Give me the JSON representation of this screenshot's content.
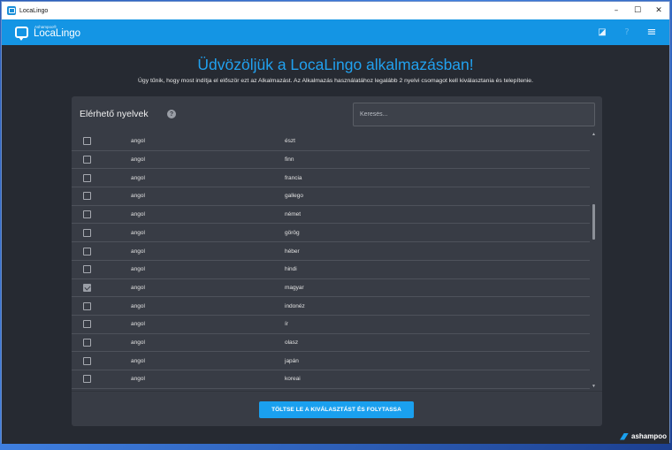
{
  "window": {
    "title": "LocaLingo",
    "minimize_glyph": "–",
    "maximize_glyph": "☐",
    "close_glyph": "✕"
  },
  "appbar": {
    "brand_small": "Ashampoo®",
    "brand_big": "LocaLingo",
    "icons": [
      "theme-toggle-icon",
      "help-icon",
      "menu-icon"
    ],
    "theme_glyph": "◪",
    "help_glyph": "?",
    "menu_glyph": "≡",
    "accent": "#1495e4"
  },
  "main": {
    "headline": "Üdvözöljük a LocaLingo alkalmazásban!",
    "subtitle": "Úgy tűnik, hogy most indítja el először ezt az Alkalmazást. Az Alkalmazás használatához legalább 2 nyelvi csomagot kell kiválasztania és telepítenie."
  },
  "panel": {
    "title": "Elérhető nyelvek",
    "help_glyph": "?",
    "search_placeholder": "Keresés...",
    "rows": [
      {
        "source": "angol",
        "target": "észt",
        "checked": false
      },
      {
        "source": "angol",
        "target": "finn",
        "checked": false
      },
      {
        "source": "angol",
        "target": "francia",
        "checked": false
      },
      {
        "source": "angol",
        "target": "gallego",
        "checked": false
      },
      {
        "source": "angol",
        "target": "német",
        "checked": false
      },
      {
        "source": "angol",
        "target": "görög",
        "checked": false
      },
      {
        "source": "angol",
        "target": "héber",
        "checked": false
      },
      {
        "source": "angol",
        "target": "hindi",
        "checked": false
      },
      {
        "source": "angol",
        "target": "magyar",
        "checked": true
      },
      {
        "source": "angol",
        "target": "indonéz",
        "checked": false
      },
      {
        "source": "angol",
        "target": "ír",
        "checked": false
      },
      {
        "source": "angol",
        "target": "olasz",
        "checked": false
      },
      {
        "source": "angol",
        "target": "japán",
        "checked": false
      },
      {
        "source": "angol",
        "target": "koreai",
        "checked": false
      }
    ],
    "scroll_up_glyph": "▲",
    "scroll_down_glyph": "▼",
    "button_label": "TÖLTSE LE A KIVÁLASZTÁST ÉS FOLYTASSA"
  },
  "footer": {
    "brand": "ashampoo"
  }
}
